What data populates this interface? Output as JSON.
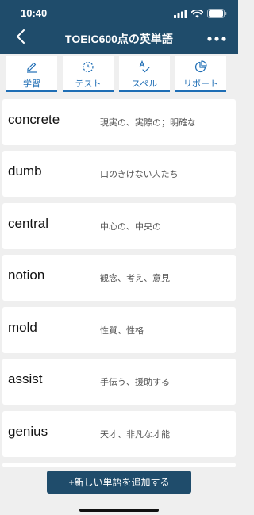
{
  "status_bar": {
    "time": "10:40"
  },
  "nav": {
    "title": "TOEIC600点の英単語",
    "back_icon": "chevron-left-icon",
    "more_icon": "ellipsis-icon"
  },
  "tabs": [
    {
      "label": "学習",
      "icon": "pencil-icon"
    },
    {
      "label": "テスト",
      "icon": "timer-icon"
    },
    {
      "label": "スペル",
      "icon": "spell-check-icon"
    },
    {
      "label": "リポート",
      "icon": "pie-chart-icon"
    }
  ],
  "words": [
    {
      "term": "concrete",
      "definition": "現実の、実際の；明確な"
    },
    {
      "term": "dumb",
      "definition": "口のきけない人たち"
    },
    {
      "term": "central",
      "definition": "中心の、中央の"
    },
    {
      "term": "notion",
      "definition": "観念、考え、意見"
    },
    {
      "term": "mold",
      "definition": "性質、性格"
    },
    {
      "term": "assist",
      "definition": "手伝う、援助する"
    },
    {
      "term": "genius",
      "definition": "天才、非凡な才能"
    }
  ],
  "bottom": {
    "add_button_label": "+新しい単語を追加する"
  },
  "colors": {
    "header_bg": "#1f4c6b",
    "tab_accent": "#1f6eb5",
    "page_bg": "#efefef"
  }
}
